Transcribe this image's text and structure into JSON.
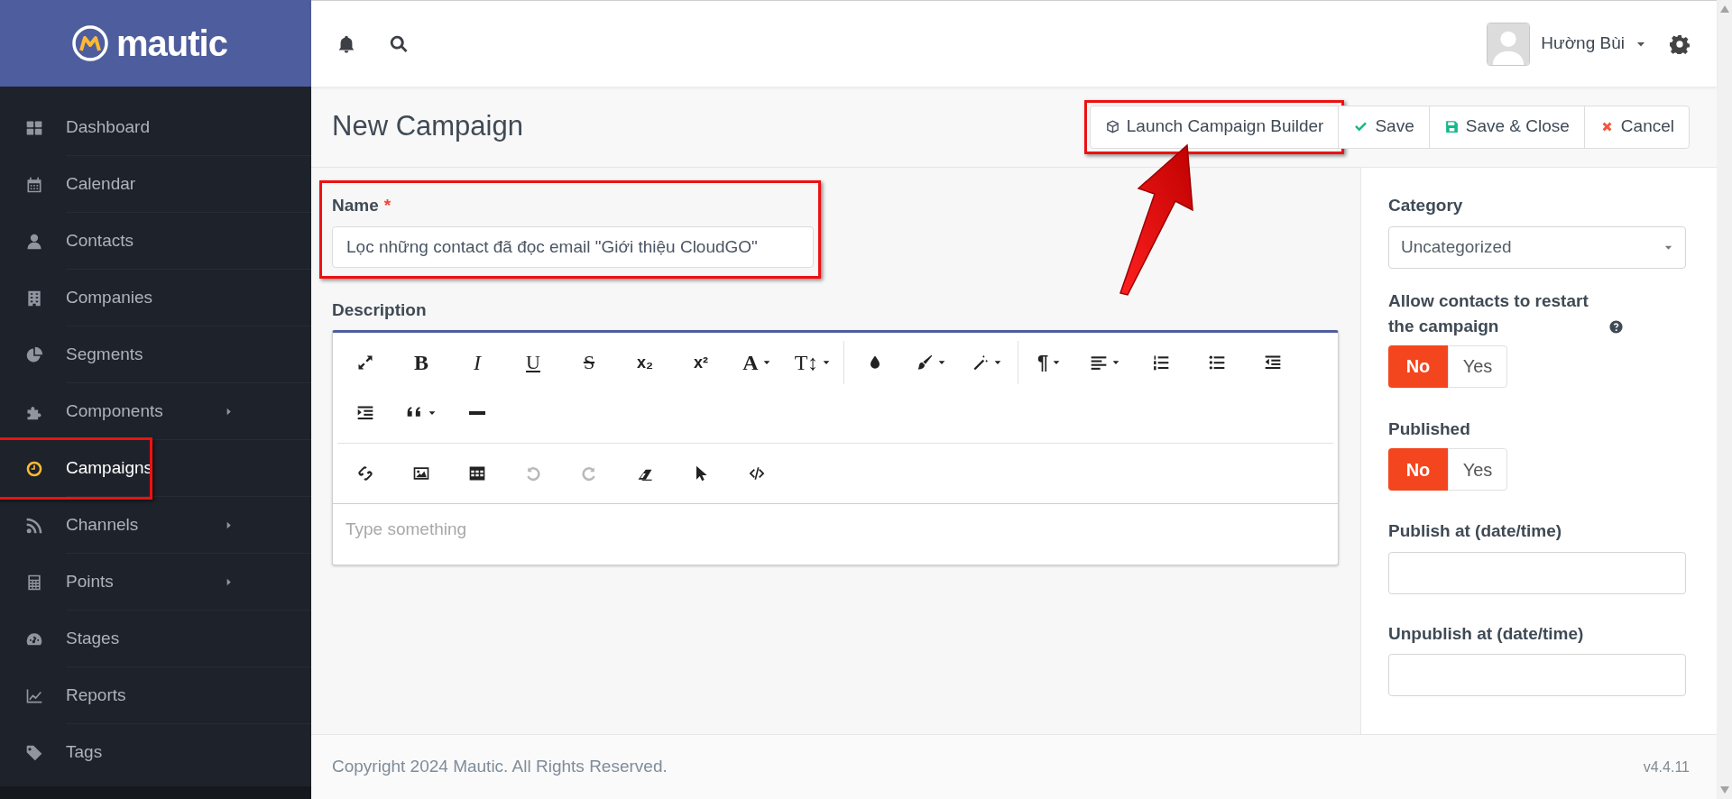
{
  "brand": {
    "name": "mautic"
  },
  "sidebar": {
    "items": [
      {
        "label": "Dashboard",
        "kind": "dashboard",
        "has_submenu": false,
        "selected": false,
        "highlighted": false
      },
      {
        "label": "Calendar",
        "kind": "calendar",
        "has_submenu": false,
        "selected": false,
        "highlighted": false
      },
      {
        "label": "Contacts",
        "kind": "user",
        "has_submenu": false,
        "selected": false,
        "highlighted": false
      },
      {
        "label": "Companies",
        "kind": "building",
        "has_submenu": false,
        "selected": false,
        "highlighted": false
      },
      {
        "label": "Segments",
        "kind": "pie",
        "has_submenu": false,
        "selected": false,
        "highlighted": false
      },
      {
        "label": "Components",
        "kind": "puzzle",
        "has_submenu": true,
        "selected": false,
        "highlighted": false
      },
      {
        "label": "Campaigns",
        "kind": "clock",
        "has_submenu": false,
        "selected": true,
        "highlighted": true
      },
      {
        "label": "Channels",
        "kind": "rss",
        "has_submenu": true,
        "selected": false,
        "highlighted": false
      },
      {
        "label": "Points",
        "kind": "calculator",
        "has_submenu": true,
        "selected": false,
        "highlighted": false
      },
      {
        "label": "Stages",
        "kind": "gauge",
        "has_submenu": false,
        "selected": false,
        "highlighted": false
      },
      {
        "label": "Reports",
        "kind": "chart",
        "has_submenu": false,
        "selected": false,
        "highlighted": false
      },
      {
        "label": "Tags",
        "kind": "tag",
        "has_submenu": false,
        "selected": false,
        "highlighted": false
      }
    ]
  },
  "topbar": {
    "user": {
      "name": "Hường Bùi"
    }
  },
  "page": {
    "title": "New Campaign",
    "actions": [
      {
        "label": "Launch Campaign Builder",
        "kind": "builder",
        "highlighted": true
      },
      {
        "label": "Save",
        "kind": "save",
        "highlighted": false
      },
      {
        "label": "Save & Close",
        "kind": "save_close",
        "highlighted": false
      },
      {
        "label": "Cancel",
        "kind": "cancel",
        "highlighted": false
      }
    ]
  },
  "form": {
    "name": {
      "label": "Name",
      "required_mark": "*",
      "value": "Lọc những contact đã đọc email \"Giới thiệu CloudGO\"",
      "highlighted": true
    },
    "description": {
      "label": "Description",
      "placeholder": "Type something",
      "toolbar": {
        "bands": [
          {
            "rows": [
              [
                {
                  "kind": "fullscreen"
                },
                {
                  "kind": "bold",
                  "glyph": "B"
                },
                {
                  "kind": "italic",
                  "glyph": "I"
                },
                {
                  "kind": "underline",
                  "glyph": "U"
                },
                {
                  "kind": "strike",
                  "glyph": "S"
                },
                {
                  "kind": "subscript",
                  "glyph": "x₂"
                },
                {
                  "kind": "superscript",
                  "glyph": "x²"
                },
                {
                  "kind": "font",
                  "glyph": "A",
                  "dropdown": true
                },
                {
                  "kind": "size",
                  "glyph": "T↕",
                  "dropdown": true
                },
                {
                  "kind": "separator"
                },
                {
                  "kind": "color"
                },
                {
                  "kind": "brush",
                  "dropdown": true
                },
                {
                  "kind": "magic",
                  "dropdown": true
                },
                {
                  "kind": "separator"
                },
                {
                  "kind": "paragraph",
                  "glyph": "¶",
                  "dropdown": true
                },
                {
                  "kind": "align",
                  "dropdown": true
                },
                {
                  "kind": "ol"
                },
                {
                  "kind": "ul"
                },
                {
                  "kind": "outdent"
                }
              ],
              [
                {
                  "kind": "indent"
                },
                {
                  "kind": "quote",
                  "dropdown": true
                },
                {
                  "kind": "hr"
                }
              ]
            ]
          },
          {
            "rows": [
              [
                {
                  "kind": "link"
                },
                {
                  "kind": "image"
                },
                {
                  "kind": "table"
                },
                {
                  "kind": "undo",
                  "disabled": true
                },
                {
                  "kind": "redo",
                  "disabled": true
                },
                {
                  "kind": "eraser"
                },
                {
                  "kind": "pointer"
                },
                {
                  "kind": "code"
                }
              ]
            ]
          }
        ]
      }
    }
  },
  "settings": {
    "category": {
      "label": "Category",
      "value": "Uncategorized"
    },
    "restart": {
      "label": "Allow contacts to restart the campaign",
      "options": [
        {
          "label": "No",
          "selected": true
        },
        {
          "label": "Yes",
          "selected": false
        }
      ]
    },
    "published": {
      "label": "Published",
      "options": [
        {
          "label": "No",
          "selected": true
        },
        {
          "label": "Yes",
          "selected": false
        }
      ]
    },
    "publish_up": {
      "label": "Publish at (date/time)"
    },
    "publish_down": {
      "label": "Unpublish at (date/time)"
    }
  },
  "footer": {
    "copyright": "Copyright 2024 Mautic. All Rights Reserved.",
    "version": "v4.4.11"
  }
}
